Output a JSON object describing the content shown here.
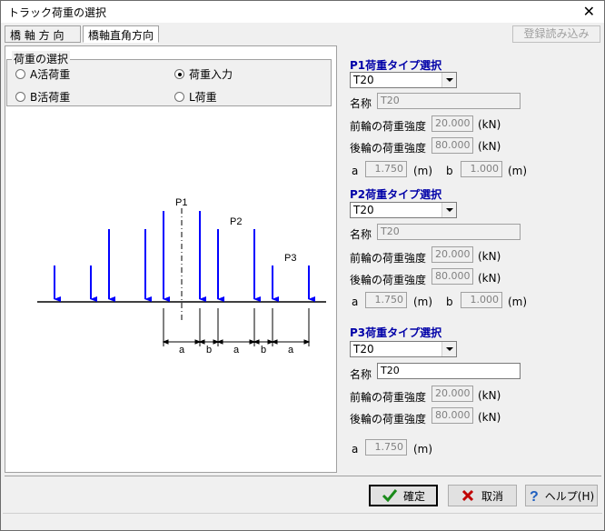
{
  "window": {
    "title": "トラック荷重の選択",
    "close_glyph": "✕"
  },
  "tabs": [
    {
      "label": "橋 軸 方 向"
    },
    {
      "label": "橋軸直角方向"
    }
  ],
  "load_button": {
    "label": "登録読み込み"
  },
  "load_selection": {
    "group_label": "荷重の選択",
    "options": [
      {
        "label": "A活荷重",
        "selected": false
      },
      {
        "label": "荷重入力",
        "selected": true
      },
      {
        "label": "B活荷重",
        "selected": false
      },
      {
        "label": "L荷重",
        "selected": false
      }
    ]
  },
  "diagram": {
    "labels": {
      "p1": "P1",
      "p2": "P2",
      "p3": "P3",
      "a": "a",
      "b": "b"
    },
    "arrow_color": "#0000ff"
  },
  "p1": {
    "title": "P1荷重タイプ選択",
    "type_value": "T20",
    "name_label": "名称",
    "name_value": "T20",
    "front_label": "前輪の荷重強度",
    "front_value": "20.000",
    "rear_label": "後輪の荷重強度",
    "rear_value": "80.000",
    "unit_kn": "(kN)",
    "a_label": "a",
    "a_value": "1.750",
    "b_label": "b",
    "b_value": "1.000",
    "unit_m": "(m)"
  },
  "p2": {
    "title": "P2荷重タイプ選択",
    "type_value": "T20",
    "name_label": "名称",
    "name_value": "T20",
    "front_label": "前輪の荷重強度",
    "front_value": "20.000",
    "rear_label": "後輪の荷重強度",
    "rear_value": "80.000",
    "unit_kn": "(kN)",
    "a_label": "a",
    "a_value": "1.750",
    "b_label": "b",
    "b_value": "1.000",
    "unit_m": "(m)"
  },
  "p3": {
    "title": "P3荷重タイプ選択",
    "type_value": "T20",
    "name_label": "名称",
    "name_value": "T20",
    "front_label": "前輪の荷重強度",
    "front_value": "20.000",
    "rear_label": "後輪の荷重強度",
    "rear_value": "80.000",
    "unit_kn": "(kN)",
    "a_label": "a",
    "a_value": "1.750",
    "unit_m": "(m)"
  },
  "buttons": {
    "ok": "確定",
    "cancel": "取消",
    "help": "ヘルプ(H)"
  },
  "colors": {
    "section_title": "#0000a8",
    "check_green": "#1a8a1a",
    "cancel_red": "#c00000",
    "help_blue": "#1f5fbf"
  }
}
